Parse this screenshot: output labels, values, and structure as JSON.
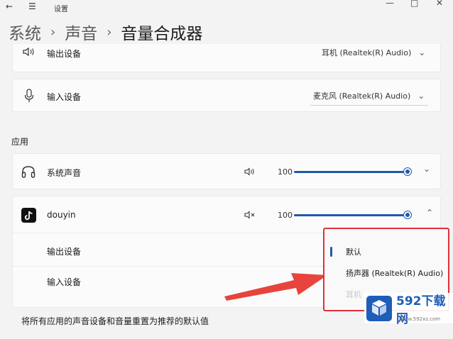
{
  "window": {
    "title": "设置"
  },
  "breadcrumb": {
    "items": [
      "系统",
      "声音"
    ],
    "current": "音量合成器"
  },
  "devices": {
    "output": {
      "label": "输出设备",
      "value": "耳机 (Realtek(R) Audio)"
    },
    "input": {
      "label": "输入设备",
      "value": "麦克风 (Realtek(R) Audio)"
    }
  },
  "apps_section": {
    "title": "应用"
  },
  "apps": [
    {
      "name": "系统声音",
      "volume": "100",
      "volume_level": 100,
      "expanded": false
    },
    {
      "name": "douyin",
      "volume": "100",
      "volume_level": 100,
      "expanded": true
    }
  ],
  "expanded_app": {
    "output_label": "输出设备",
    "input_label": "输入设备"
  },
  "popup_menu": {
    "items": [
      "默认",
      "扬声器 (Realtek(R) Audio)",
      "耳机"
    ],
    "selected": "默认"
  },
  "reset": {
    "label": "将所有应用的声音设备和音量重置为推荐的默认值"
  },
  "watermark": {
    "brand": "592下载网",
    "url": "www.592xz.com"
  },
  "colors": {
    "accent": "#1f5aa8",
    "highlight": "#e0303a"
  }
}
